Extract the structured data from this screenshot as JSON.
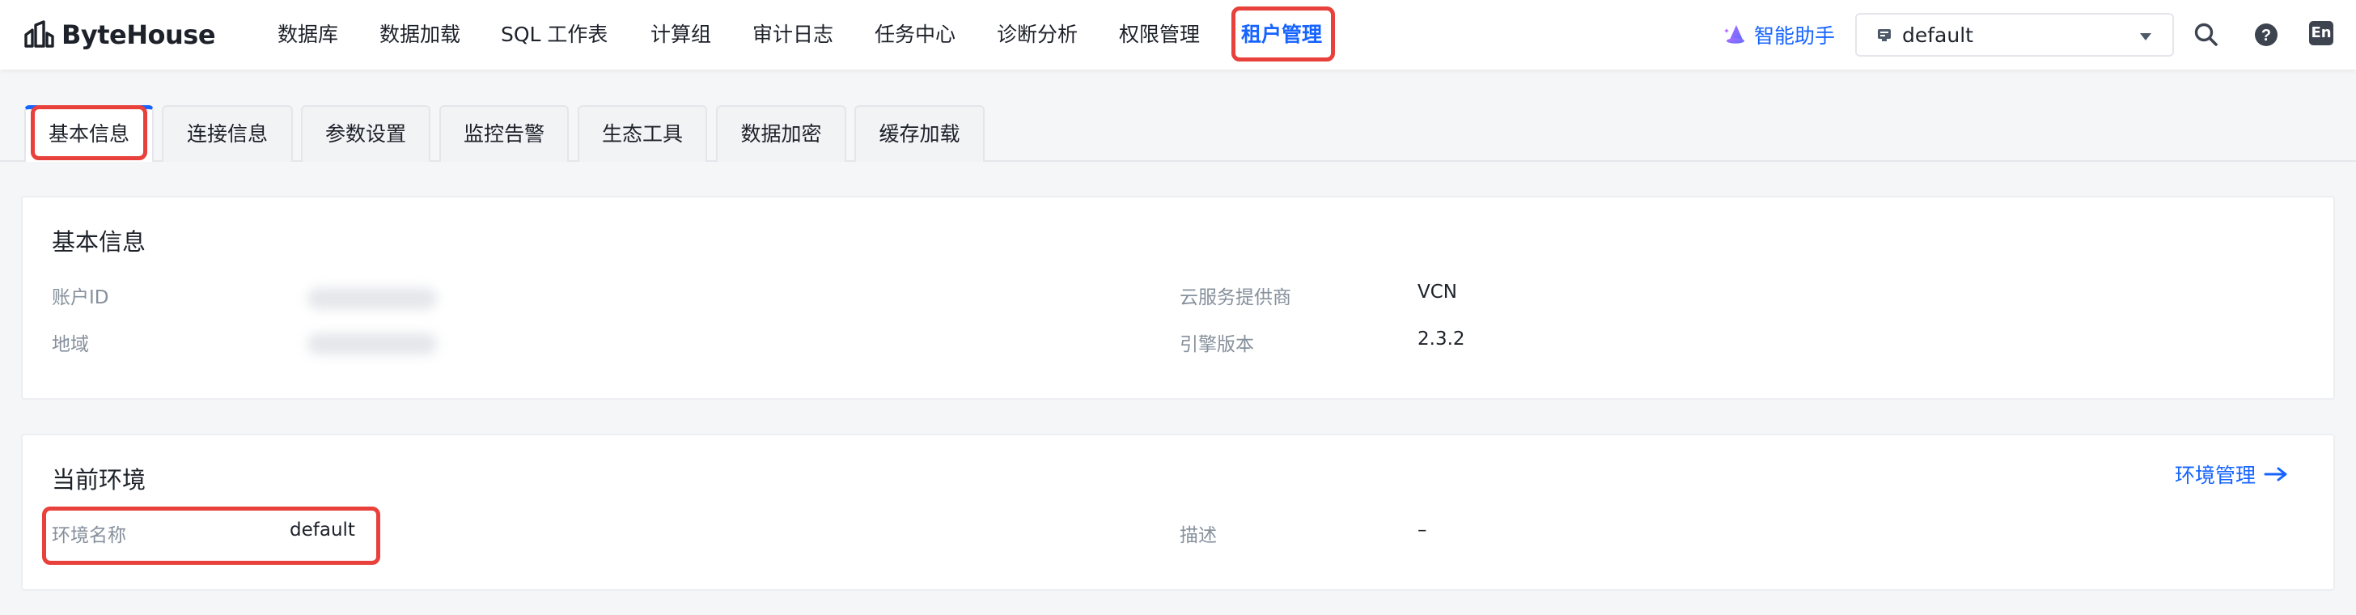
{
  "brand": {
    "name": "ByteHouse"
  },
  "nav": {
    "items": [
      "数据库",
      "数据加载",
      "SQL 工作表",
      "计算组",
      "审计日志",
      "任务中心",
      "诊断分析",
      "权限管理",
      "租户管理"
    ],
    "active": "租户管理"
  },
  "header": {
    "assistant_label": "智能助手",
    "env_select_value": "default",
    "lang_label": "En",
    "icons": [
      "search-icon",
      "help-icon",
      "language-icon"
    ]
  },
  "tabs": {
    "items": [
      "基本信息",
      "连接信息",
      "参数设置",
      "监控告警",
      "生态工具",
      "数据加密",
      "缓存加载"
    ],
    "active": "基本信息"
  },
  "basic_info": {
    "title": "基本信息",
    "fields": [
      {
        "label": "账户ID",
        "value": ""
      },
      {
        "label": "地域",
        "value": ""
      },
      {
        "label": "云服务提供商",
        "value": "VCN"
      },
      {
        "label": "引擎版本",
        "value": "2.3.2"
      }
    ]
  },
  "current_env": {
    "title": "当前环境",
    "manage_link": "环境管理",
    "fields": [
      {
        "label": "环境名称",
        "value": "default"
      },
      {
        "label": "描述",
        "value": "–"
      }
    ]
  },
  "colors": {
    "accent": "#1664ff",
    "highlight": "#e8413b",
    "label": "#86909c",
    "text": "#1d2129"
  }
}
